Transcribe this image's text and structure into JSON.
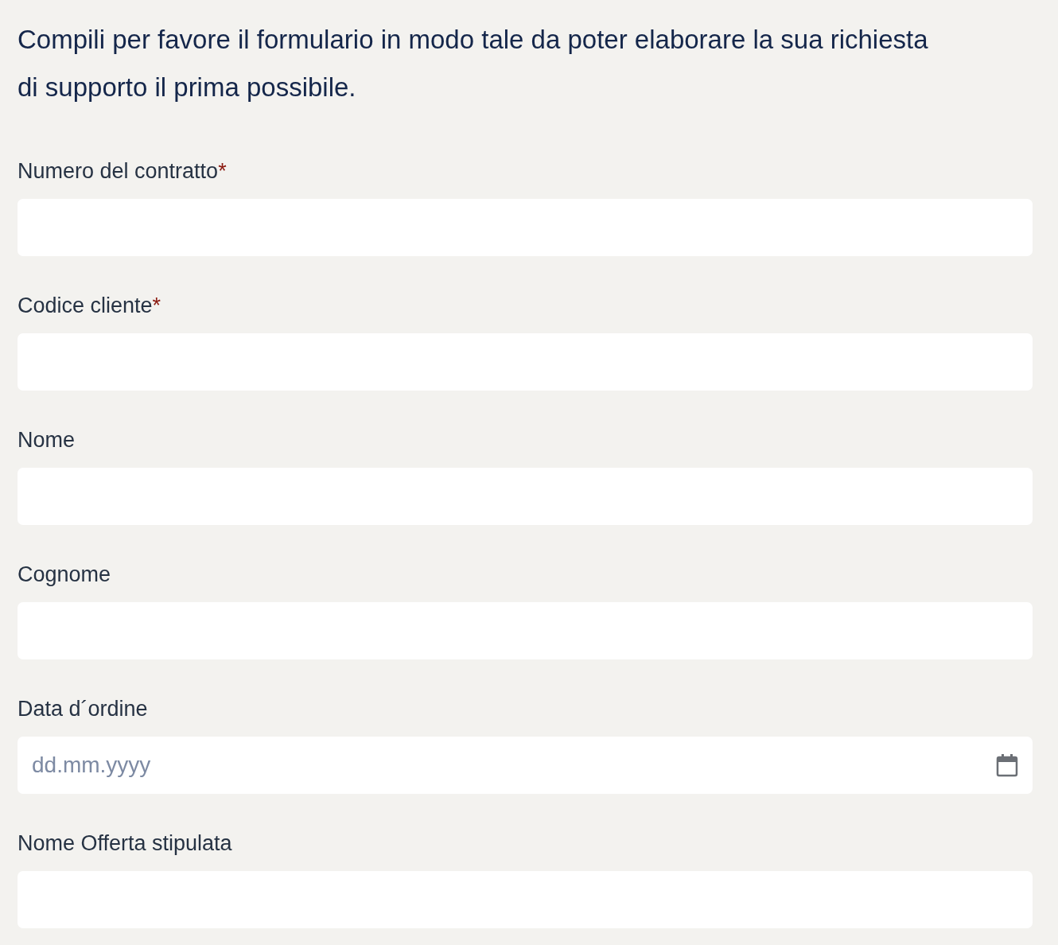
{
  "intro": "Compili per favore il formulario in modo tale da poter elaborare la sua richiesta di supporto il prima possibile.",
  "fields": [
    {
      "kind": "text",
      "label": "Numero del contratto",
      "required_mark": "*"
    },
    {
      "kind": "text",
      "label": "Codice cliente",
      "required_mark": "*"
    },
    {
      "kind": "text",
      "label": "Nome"
    },
    {
      "kind": "text",
      "label": "Cognome"
    },
    {
      "kind": "date",
      "label": "Data d´ordine",
      "placeholder": "dd.mm.yyyy"
    },
    {
      "kind": "text",
      "label": "Nome Offerta stipulata"
    }
  ]
}
